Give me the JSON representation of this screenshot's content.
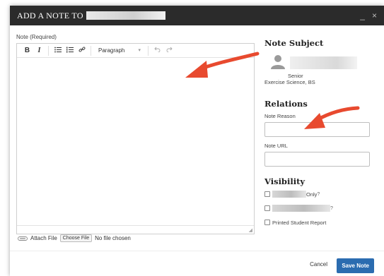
{
  "modal": {
    "title": "ADD A NOTE TO",
    "minimize": "_",
    "close": "×"
  },
  "editor": {
    "label": "Note (Required)",
    "toolbar": {
      "bold": "B",
      "italic": "I",
      "format_select": "Paragraph",
      "icons": [
        "bold-icon",
        "italic-icon",
        "bullet-list-icon",
        "numbered-list-icon",
        "link-icon",
        "undo-icon",
        "redo-icon"
      ]
    }
  },
  "attach": {
    "label": "Attach File",
    "button": "Choose File",
    "status": "No file chosen"
  },
  "note_subject": {
    "heading": "Note Subject",
    "class_year": "Senior",
    "major": "Exercise Science, BS"
  },
  "relations": {
    "heading": "Relations",
    "reason_label": "Note Reason",
    "url_label": "Note URL"
  },
  "visibility": {
    "heading": "Visibility",
    "option1_suffix": "Only",
    "help_mark": "?",
    "printed_label": "Printed Student Report"
  },
  "footer": {
    "cancel": "Cancel",
    "save": "Save Note"
  },
  "colors": {
    "titlebar": "#2b2b2b",
    "save_button": "#2b6cb0",
    "arrow": "#e84a2f"
  }
}
